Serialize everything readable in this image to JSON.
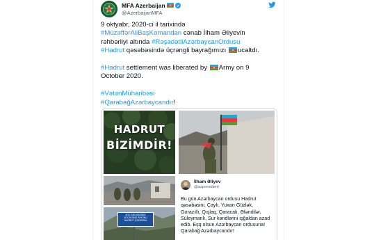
{
  "tweet": {
    "author": {
      "name": "MFA Azerbaijan",
      "handle": "@AzerbaijanMFA"
    },
    "text": {
      "az_line1": "9 oktyabr, 2020-ci il tarixində",
      "az_tag1": "#MüzəffərAliBaşKomandan",
      "az_mid1": " cənab İlham Əliyevin",
      "az_mid2": "rəhbərliyi altında ",
      "az_tag2": "#RəşadətliAzərbaycanOrdusu",
      "az_tag3": "#Hadrut",
      "az_mid3": " qəsəbəsində üçrəngli bayrağımızı",
      "az_end": "ucaltdı.",
      "en_tag": "#Hadrut",
      "en_mid": " settlement was liberated by ",
      "en_mid2": "Army on 9",
      "en_end": "October 2020.",
      "tag4": "#VətənMüharibəsi",
      "tag5": "#QarabağAzərbaycandır",
      "tag5_suffix": "!"
    }
  },
  "media": {
    "poster_line1": "HADRUT",
    "poster_line2": "BİZİMDİR!",
    "sign_text": [
      "XOŞ GƏLMİŞSİNİZ",
      "XOCAVƏND RAYONU",
      "HADRUT QƏSƏBƏSİ"
    ]
  },
  "quoted": {
    "name": "İlham Əliyev",
    "handle": "@azpresident",
    "text": "Bu gün Azərbaycan ordusu Hadrut qəsəbəsini, Çaylı, Yuxarı Güzlək, Gorazıllı, Qışlaq, Qaracalı, Əfəndilər, Süleymanlı, Sur kəndlərini işğaldan azad edib. Eşq olsun Azərbaycan ordusuna! Qarabağ Azərbaycandır!"
  },
  "colors": {
    "hashtag": "#1d9bf0",
    "text": "#0f1419",
    "muted": "#536471",
    "flag_blue": "#00b5e2",
    "flag_red": "#ef3340",
    "flag_green": "#509e2f"
  },
  "icons": [
    "azerbaijan-coat-of-arms-avatar",
    "azerbaijan-flag-icon",
    "verified-badge-icon",
    "twitter-bird-icon"
  ]
}
